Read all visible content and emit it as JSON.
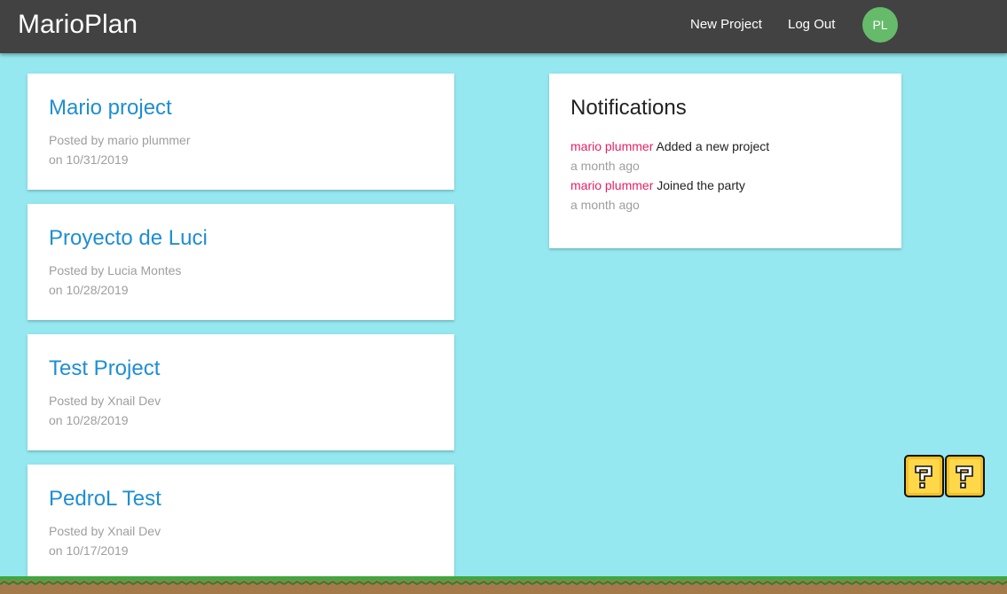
{
  "nav": {
    "brand": "MarioPlan",
    "links": [
      {
        "label": "New Project"
      },
      {
        "label": "Log Out"
      }
    ],
    "avatar_initials": "PL",
    "avatar_color": "#66bb6a"
  },
  "projects": [
    {
      "title": "Mario project",
      "author": "Posted by mario plummer",
      "date": "on 10/31/2019"
    },
    {
      "title": "Proyecto de Luci",
      "author": "Posted by Lucia Montes",
      "date": "on 10/28/2019"
    },
    {
      "title": "Test Project",
      "author": "Posted by Xnail Dev",
      "date": "on 10/28/2019"
    },
    {
      "title": "PedroL Test",
      "author": "Posted by Xnail Dev",
      "date": "on 10/17/2019"
    }
  ],
  "notifications": {
    "heading": "Notifications",
    "items": [
      {
        "user": "mario plummer",
        "content": "Added a new project",
        "time": "a month ago"
      },
      {
        "user": "mario plummer",
        "content": "Joined the party",
        "time": "a month ago"
      }
    ]
  },
  "decor": {
    "blocks_icon": "question-block-icon",
    "ground_icon": "ground-strip"
  },
  "colors": {
    "background": "#95e8f0",
    "navbar": "#424242",
    "project_title": "#1e8ed3",
    "notif_user": "#e91e63",
    "muted": "#9e9e9e"
  }
}
